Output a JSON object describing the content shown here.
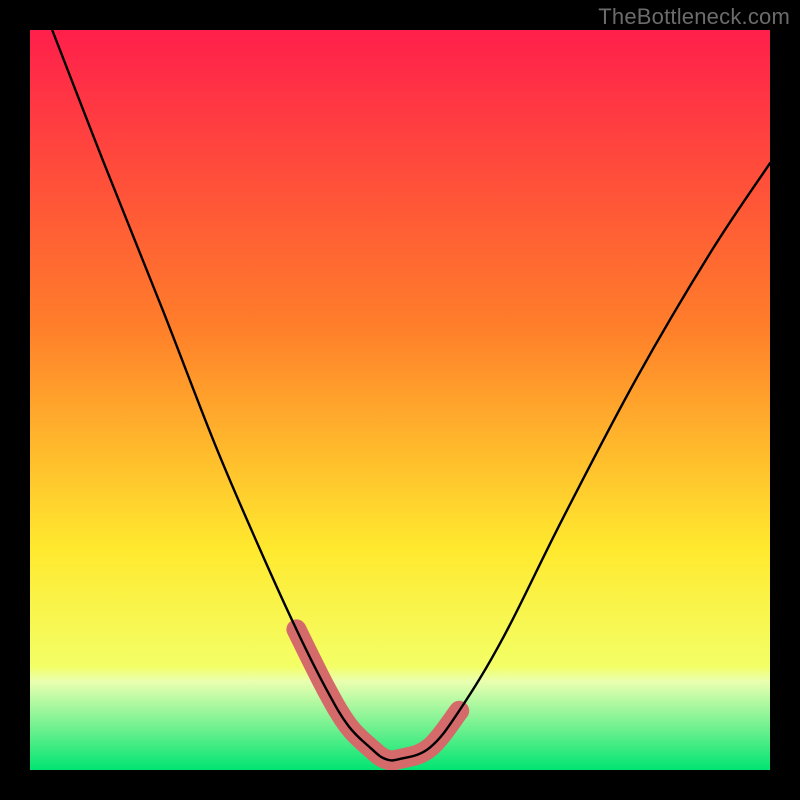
{
  "watermark": "TheBottleneck.com",
  "chart_data": {
    "type": "line",
    "title": "",
    "xlabel": "",
    "ylabel": "",
    "xlim": [
      0,
      100
    ],
    "ylim": [
      0,
      100
    ],
    "series": [
      {
        "name": "curve",
        "x": [
          3,
          10,
          18,
          25,
          31,
          36,
          40,
          43,
          46,
          48,
          50,
          54,
          58,
          64,
          72,
          82,
          92,
          100
        ],
        "y": [
          100,
          82,
          62,
          44,
          30,
          19,
          11,
          6,
          3,
          1.5,
          1.5,
          3,
          8,
          18,
          34,
          53,
          70,
          82
        ]
      }
    ],
    "highlight_band": {
      "name": "optimal-zone",
      "color": "#d46a6a",
      "x": [
        36,
        40,
        43,
        46,
        48,
        50,
        54,
        58
      ],
      "y": [
        19,
        11,
        6,
        3,
        1.5,
        1.5,
        3,
        8
      ]
    },
    "background_gradient": {
      "top": "#ff1f4b",
      "mid1": "#ff7e2a",
      "mid2": "#ffe92e",
      "bottom": "#00e472"
    }
  }
}
